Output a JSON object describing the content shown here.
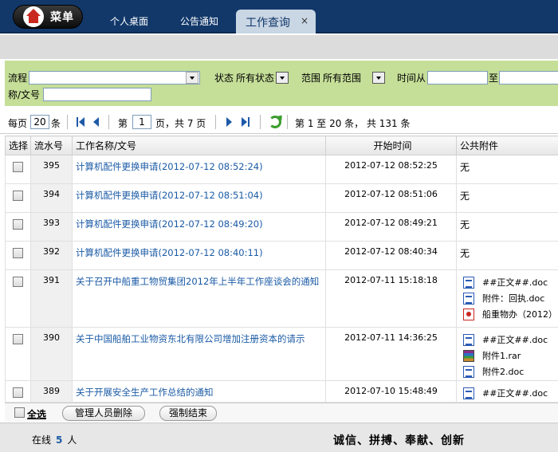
{
  "menu": {
    "label": "菜单"
  },
  "nav": {
    "tabs": [
      {
        "label": "个人桌面"
      },
      {
        "label": "公告通知"
      }
    ],
    "active_tab": {
      "label": "工作查询",
      "close": "×"
    }
  },
  "filter": {
    "flow_label": "流程",
    "status_label": "状态",
    "status_value": "所有状态",
    "scope_label": "范围",
    "scope_value": "所有范围",
    "time_from_label": "时间从",
    "time_to_label": "至",
    "name_label": "称/文号"
  },
  "pager": {
    "per_page_label": "每页",
    "per_page_value": "20",
    "per_page_unit": "条",
    "page_prefix": "第",
    "page_value": "1",
    "page_suffix": "页，共 7 页",
    "summary": "第 1 至 20 条， 共 131 条"
  },
  "table": {
    "headers": {
      "select": "选择",
      "no": "流水号",
      "name": "工作名称/文号",
      "time": "开始时间",
      "attach": "公共附件"
    },
    "rows": [
      {
        "no": "395",
        "name": "计算机配件更换申请(2012-07-12 08:52:24)",
        "time": "2012-07-12 08:52:25",
        "attach_text": "无"
      },
      {
        "no": "394",
        "name": "计算机配件更换申请(2012-07-12 08:51:04)",
        "time": "2012-07-12 08:51:06",
        "attach_text": "无"
      },
      {
        "no": "393",
        "name": "计算机配件更换申请(2012-07-12 08:49:20)",
        "time": "2012-07-12 08:49:21",
        "attach_text": "无"
      },
      {
        "no": "392",
        "name": "计算机配件更换申请(2012-07-12 08:40:11)",
        "time": "2012-07-12 08:40:34",
        "attach_text": "无"
      },
      {
        "no": "391",
        "name": "关于召开中船重工物贸集团2012年上半年工作座谈会的通知",
        "time": "2012-07-11 15:18:18",
        "attachments": [
          {
            "name": "##正文##.doc",
            "icon": "word-doc-icon"
          },
          {
            "name": "附件：回执.doc",
            "icon": "word-doc-icon"
          },
          {
            "name": "船重物办（2012）",
            "icon": "pdf-icon"
          }
        ]
      },
      {
        "no": "390",
        "name": "关于中国船舶工业物资东北有限公司增加注册资本的请示",
        "time": "2012-07-11 14:36:25",
        "attachments": [
          {
            "name": "##正文##.doc",
            "icon": "word-doc-icon"
          },
          {
            "name": "附件1.rar",
            "icon": "rar-archive-icon"
          },
          {
            "name": "附件2.doc",
            "icon": "word-doc-icon"
          }
        ]
      },
      {
        "no": "389",
        "name": "关于开展安全生产工作总结的通知",
        "time": "2012-07-10 15:48:49",
        "attachments": [
          {
            "name": "##正文##.doc",
            "icon": "word-doc-icon"
          }
        ]
      }
    ]
  },
  "actions": {
    "select_all": "全选",
    "admin_delete": "管理人员删除",
    "force_end": "强制结束"
  },
  "status": {
    "online_label": "在线",
    "online_count": "5",
    "online_unit": "人",
    "slogan": "诚信、拼搏、奉献、创新"
  }
}
